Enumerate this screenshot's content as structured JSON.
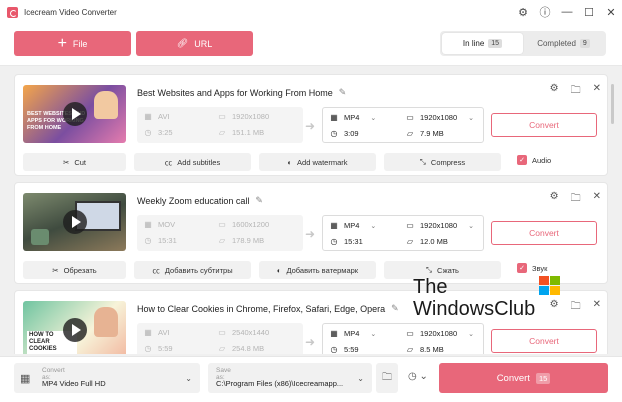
{
  "app": {
    "title": "Icecream Video Converter"
  },
  "toolbar": {
    "file_label": "File",
    "url_label": "URL"
  },
  "tabs": [
    {
      "label": "In line",
      "count": "15"
    },
    {
      "label": "Completed",
      "count": "9"
    }
  ],
  "items": [
    {
      "title": "Best Websites and Apps for Working From Home",
      "thumb_text": "BEST WEBSITES AND APPS FOR WORKING FROM HOME",
      "source": {
        "format": "AVI",
        "resolution": "1920x1080",
        "duration": "3:25",
        "size": "151.1 MB"
      },
      "output": {
        "format": "MP4",
        "resolution": "1920x1080",
        "duration": "3:09",
        "size": "7.9 MB"
      },
      "convert_label": "Convert",
      "actions": [
        "Cut",
        "Add subtitles",
        "Add watermark",
        "Compress"
      ],
      "audio_label": "Audio"
    },
    {
      "title": "Weekly Zoom education call",
      "source": {
        "format": "MOV",
        "resolution": "1600x1200",
        "duration": "15:31",
        "size": "178.9 MB"
      },
      "output": {
        "format": "MP4",
        "resolution": "1920x1080",
        "duration": "15:31",
        "size": "12.0 MB"
      },
      "convert_label": "Convert",
      "actions": [
        "Обрезать",
        "Добавить субтитры",
        "Добавить ватермарк",
        "Сжать"
      ],
      "audio_label": "Звук"
    },
    {
      "title": "How to Clear Cookies in Chrome, Firefox, Safari, Edge, Opera",
      "thumb_text": "HOW TO CLEAR COOKIES",
      "source": {
        "format": "AVI",
        "resolution": "2540x1440",
        "duration": "5:59",
        "size": "254.8 MB"
      },
      "output": {
        "format": "MP4",
        "resolution": "1920x1080",
        "duration": "5:59",
        "size": "8.5 MB"
      },
      "convert_label": "Convert"
    }
  ],
  "watermark": {
    "line1": "The",
    "line2": "WindowsClub"
  },
  "bottom": {
    "convert_as_label": "Convert as:",
    "convert_as_value": "MP4 Video Full HD",
    "save_as_label": "Save as:",
    "save_as_value": "C:\\Program Files (x86)\\Icecreamapp...",
    "convert_label": "Convert",
    "convert_count": "15"
  },
  "colors": {
    "accent": "#e8677a"
  }
}
